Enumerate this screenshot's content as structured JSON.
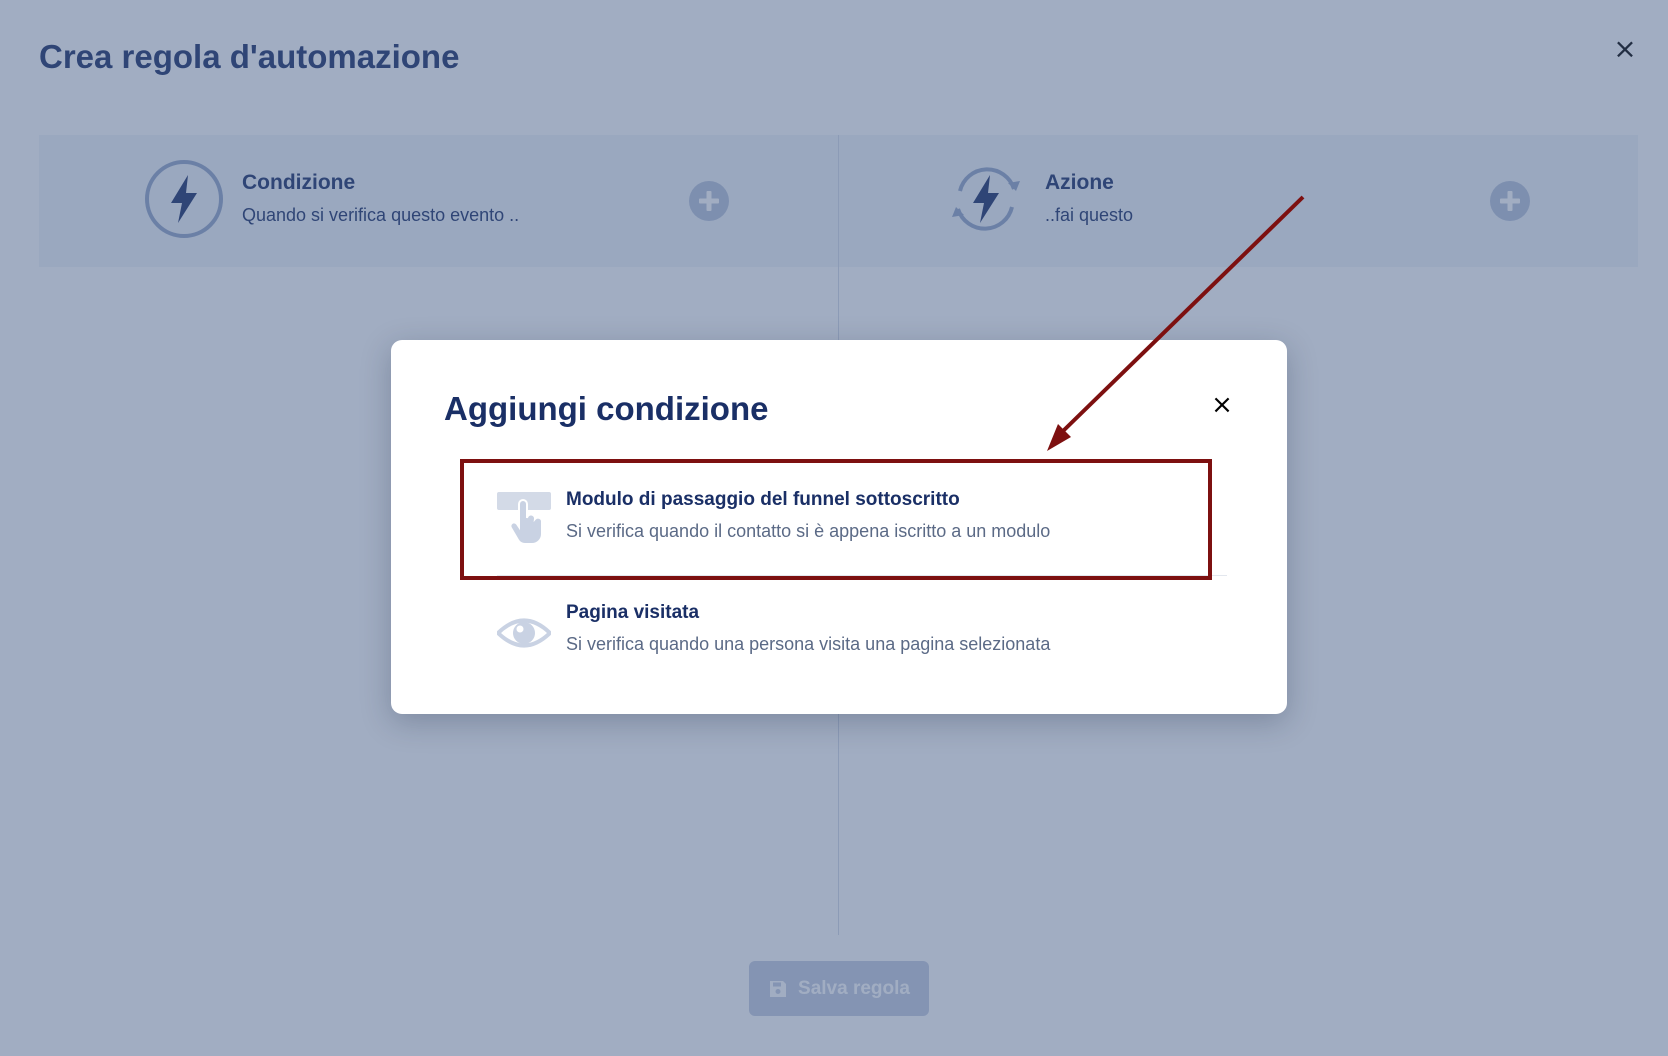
{
  "page": {
    "title": "Crea regola d'automazione",
    "close_symbol": "×"
  },
  "panels": {
    "condition": {
      "title": "Condizione",
      "subtitle": "Quando si verifica questo evento ..",
      "icon": "lightning-icon",
      "add_icon": "plus-circle-icon"
    },
    "action": {
      "title": "Azione",
      "subtitle": "..fai questo",
      "icon": "lightning-cycle-icon",
      "add_icon": "plus-circle-icon"
    }
  },
  "footer": {
    "save_label": "Salva regola",
    "save_icon": "floppy-disk-icon"
  },
  "modal": {
    "title": "Aggiungi condizione",
    "close_symbol": "×",
    "options": [
      {
        "title": "Modulo di passaggio del funnel sottoscritto",
        "description": "Si verifica quando il contatto si è appena iscritto a un modulo",
        "icon": "hand-pointer-form-icon"
      },
      {
        "title": "Pagina visitata",
        "description": "Si verifica quando una persona visita una pagina selezionata",
        "icon": "eye-icon"
      }
    ]
  },
  "colors": {
    "title_navy": "#1a2f66",
    "overlay": "#445b85",
    "highlight_border": "#7d1010",
    "arrow": "#7d1010"
  }
}
